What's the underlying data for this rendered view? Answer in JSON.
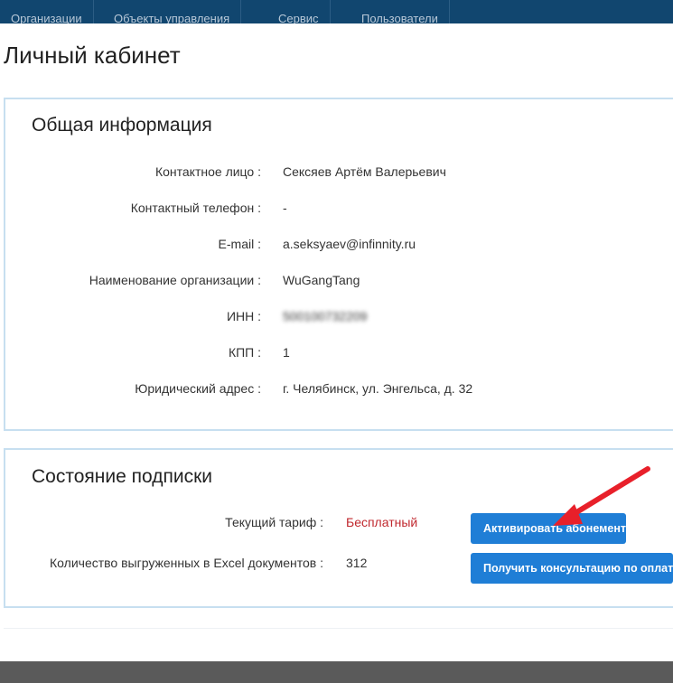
{
  "nav": {
    "tabs": [
      "Организации",
      "Объекты управления",
      "Сервис",
      "Пользователи"
    ]
  },
  "page": {
    "title": "Личный кабинет"
  },
  "info": {
    "heading": "Общая информация",
    "rows": [
      {
        "label": "Контактное лицо :",
        "value": "Сексяев Артём Валерьевич"
      },
      {
        "label": "Контактный телефон :",
        "value": "-"
      },
      {
        "label": "E-mail :",
        "value": "a.seksyaev@infinnity.ru"
      },
      {
        "label": "Наименование организации :",
        "value": "WuGangTang"
      },
      {
        "label": "ИНН :",
        "value": "500100732209"
      },
      {
        "label": "КПП :",
        "value": "1"
      },
      {
        "label": "Юридический адрес :",
        "value": "г. Челябинск, ул. Энгельса, д. 32"
      }
    ]
  },
  "subscription": {
    "heading": "Состояние подписки",
    "tariff_label": "Текущий тариф :",
    "tariff_value": "Бесплатный",
    "count_label": "Количество выгруженных в Excel документов :",
    "count_value": "312",
    "activate_button": "Активировать абонемент",
    "consult_button": "Получить консультацию по оплате"
  },
  "colors": {
    "nav_bg": "#11466f",
    "accent_button": "#1f7ed6",
    "tariff_red": "#c0282e",
    "arrow_red": "#e8202a"
  }
}
